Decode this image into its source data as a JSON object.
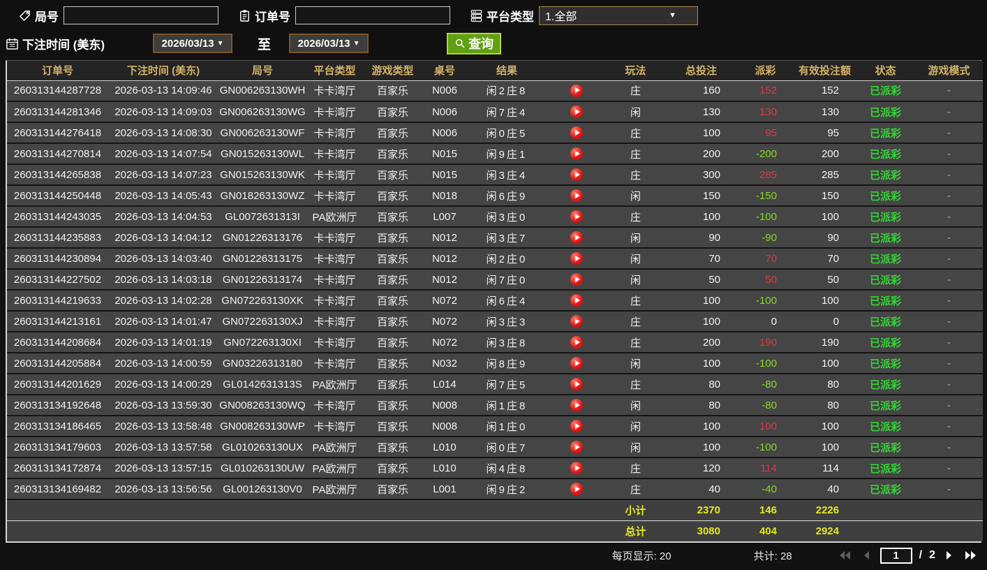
{
  "filters": {
    "round_label": "局号",
    "round_value": "",
    "order_label": "订单号",
    "order_value": "",
    "platform_label": "平台类型",
    "platform_value": "1.全部",
    "bet_time_label": "下注时间 (美东)",
    "date_from": "2026/03/13",
    "to_label": "至",
    "date_to": "2026/03/13",
    "search_label": "查询"
  },
  "table": {
    "columns": [
      "订单号",
      "下注时间 (美东)",
      "局号",
      "平台类型",
      "游戏类型",
      "桌号",
      "结果",
      "",
      "玩法",
      "总投注",
      "派彩",
      "有效投注额",
      "状态",
      "游戏模式"
    ],
    "rows": [
      {
        "order_id": "260313144287728",
        "bet_time": "2026-03-13 14:09:46",
        "round_id": "GN006263130WH",
        "platform": "卡卡湾厅",
        "game_type": "百家乐",
        "table_no": "N006",
        "result": "闲2庄8",
        "play": "庄",
        "total_bet": "160",
        "payout": "152",
        "payout_color": "red",
        "valid_bet": "152",
        "status": "已派彩",
        "mode": "-"
      },
      {
        "order_id": "260313144281346",
        "bet_time": "2026-03-13 14:09:03",
        "round_id": "GN006263130WG",
        "platform": "卡卡湾厅",
        "game_type": "百家乐",
        "table_no": "N006",
        "result": "闲7庄4",
        "play": "闲",
        "total_bet": "130",
        "payout": "130",
        "payout_color": "red",
        "valid_bet": "130",
        "status": "已派彩",
        "mode": "-"
      },
      {
        "order_id": "260313144276418",
        "bet_time": "2026-03-13 14:08:30",
        "round_id": "GN006263130WF",
        "platform": "卡卡湾厅",
        "game_type": "百家乐",
        "table_no": "N006",
        "result": "闲0庄5",
        "play": "庄",
        "total_bet": "100",
        "payout": "95",
        "payout_color": "red",
        "valid_bet": "95",
        "status": "已派彩",
        "mode": "-"
      },
      {
        "order_id": "260313144270814",
        "bet_time": "2026-03-13 14:07:54",
        "round_id": "GN015263130WL",
        "platform": "卡卡湾厅",
        "game_type": "百家乐",
        "table_no": "N015",
        "result": "闲9庄1",
        "play": "庄",
        "total_bet": "200",
        "payout": "-200",
        "payout_color": "green",
        "valid_bet": "200",
        "status": "已派彩",
        "mode": "-"
      },
      {
        "order_id": "260313144265838",
        "bet_time": "2026-03-13 14:07:23",
        "round_id": "GN015263130WK",
        "platform": "卡卡湾厅",
        "game_type": "百家乐",
        "table_no": "N015",
        "result": "闲3庄4",
        "play": "庄",
        "total_bet": "300",
        "payout": "285",
        "payout_color": "red",
        "valid_bet": "285",
        "status": "已派彩",
        "mode": "-"
      },
      {
        "order_id": "260313144250448",
        "bet_time": "2026-03-13 14:05:43",
        "round_id": "GN018263130WZ",
        "platform": "卡卡湾厅",
        "game_type": "百家乐",
        "table_no": "N018",
        "result": "闲6庄9",
        "play": "闲",
        "total_bet": "150",
        "payout": "-150",
        "payout_color": "green",
        "valid_bet": "150",
        "status": "已派彩",
        "mode": "-"
      },
      {
        "order_id": "260313144243035",
        "bet_time": "2026-03-13 14:04:53",
        "round_id": "GL0072631313I",
        "platform": "PA欧洲厅",
        "game_type": "百家乐",
        "table_no": "L007",
        "result": "闲3庄0",
        "play": "庄",
        "total_bet": "100",
        "payout": "-100",
        "payout_color": "green",
        "valid_bet": "100",
        "status": "已派彩",
        "mode": "-"
      },
      {
        "order_id": "260313144235883",
        "bet_time": "2026-03-13 14:04:12",
        "round_id": "GN01226313176",
        "platform": "卡卡湾厅",
        "game_type": "百家乐",
        "table_no": "N012",
        "result": "闲3庄7",
        "play": "闲",
        "total_bet": "90",
        "payout": "-90",
        "payout_color": "green",
        "valid_bet": "90",
        "status": "已派彩",
        "mode": "-"
      },
      {
        "order_id": "260313144230894",
        "bet_time": "2026-03-13 14:03:40",
        "round_id": "GN01226313175",
        "platform": "卡卡湾厅",
        "game_type": "百家乐",
        "table_no": "N012",
        "result": "闲2庄0",
        "play": "闲",
        "total_bet": "70",
        "payout": "70",
        "payout_color": "red",
        "valid_bet": "70",
        "status": "已派彩",
        "mode": "-"
      },
      {
        "order_id": "260313144227502",
        "bet_time": "2026-03-13 14:03:18",
        "round_id": "GN01226313174",
        "platform": "卡卡湾厅",
        "game_type": "百家乐",
        "table_no": "N012",
        "result": "闲7庄0",
        "play": "闲",
        "total_bet": "50",
        "payout": "50",
        "payout_color": "red",
        "valid_bet": "50",
        "status": "已派彩",
        "mode": "-"
      },
      {
        "order_id": "260313144219633",
        "bet_time": "2026-03-13 14:02:28",
        "round_id": "GN072263130XK",
        "platform": "卡卡湾厅",
        "game_type": "百家乐",
        "table_no": "N072",
        "result": "闲6庄4",
        "play": "庄",
        "total_bet": "100",
        "payout": "-100",
        "payout_color": "green",
        "valid_bet": "100",
        "status": "已派彩",
        "mode": "-"
      },
      {
        "order_id": "260313144213161",
        "bet_time": "2026-03-13 14:01:47",
        "round_id": "GN072263130XJ",
        "platform": "卡卡湾厅",
        "game_type": "百家乐",
        "table_no": "N072",
        "result": "闲3庄3",
        "play": "庄",
        "total_bet": "100",
        "payout": "0",
        "payout_color": "white",
        "valid_bet": "0",
        "status": "已派彩",
        "mode": "-"
      },
      {
        "order_id": "260313144208684",
        "bet_time": "2026-03-13 14:01:19",
        "round_id": "GN072263130XI",
        "platform": "卡卡湾厅",
        "game_type": "百家乐",
        "table_no": "N072",
        "result": "闲3庄8",
        "play": "庄",
        "total_bet": "200",
        "payout": "190",
        "payout_color": "red",
        "valid_bet": "190",
        "status": "已派彩",
        "mode": "-"
      },
      {
        "order_id": "260313144205884",
        "bet_time": "2026-03-13 14:00:59",
        "round_id": "GN03226313180",
        "platform": "卡卡湾厅",
        "game_type": "百家乐",
        "table_no": "N032",
        "result": "闲8庄9",
        "play": "闲",
        "total_bet": "100",
        "payout": "-100",
        "payout_color": "green",
        "valid_bet": "100",
        "status": "已派彩",
        "mode": "-"
      },
      {
        "order_id": "260313144201629",
        "bet_time": "2026-03-13 14:00:29",
        "round_id": "GL0142631313S",
        "platform": "PA欧洲厅",
        "game_type": "百家乐",
        "table_no": "L014",
        "result": "闲7庄5",
        "play": "庄",
        "total_bet": "80",
        "payout": "-80",
        "payout_color": "green",
        "valid_bet": "80",
        "status": "已派彩",
        "mode": "-"
      },
      {
        "order_id": "260313134192648",
        "bet_time": "2026-03-13 13:59:30",
        "round_id": "GN008263130WQ",
        "platform": "卡卡湾厅",
        "game_type": "百家乐",
        "table_no": "N008",
        "result": "闲1庄8",
        "play": "闲",
        "total_bet": "80",
        "payout": "-80",
        "payout_color": "green",
        "valid_bet": "80",
        "status": "已派彩",
        "mode": "-"
      },
      {
        "order_id": "260313134186465",
        "bet_time": "2026-03-13 13:58:48",
        "round_id": "GN008263130WP",
        "platform": "卡卡湾厅",
        "game_type": "百家乐",
        "table_no": "N008",
        "result": "闲1庄0",
        "play": "闲",
        "total_bet": "100",
        "payout": "100",
        "payout_color": "red",
        "valid_bet": "100",
        "status": "已派彩",
        "mode": "-"
      },
      {
        "order_id": "260313134179603",
        "bet_time": "2026-03-13 13:57:58",
        "round_id": "GL010263130UX",
        "platform": "PA欧洲厅",
        "game_type": "百家乐",
        "table_no": "L010",
        "result": "闲0庄7",
        "play": "闲",
        "total_bet": "100",
        "payout": "-100",
        "payout_color": "green",
        "valid_bet": "100",
        "status": "已派彩",
        "mode": "-"
      },
      {
        "order_id": "260313134172874",
        "bet_time": "2026-03-13 13:57:15",
        "round_id": "GL010263130UW",
        "platform": "PA欧洲厅",
        "game_type": "百家乐",
        "table_no": "L010",
        "result": "闲4庄8",
        "play": "庄",
        "total_bet": "120",
        "payout": "114",
        "payout_color": "red",
        "valid_bet": "114",
        "status": "已派彩",
        "mode": "-"
      },
      {
        "order_id": "260313134169482",
        "bet_time": "2026-03-13 13:56:56",
        "round_id": "GL001263130V0",
        "platform": "PA欧洲厅",
        "game_type": "百家乐",
        "table_no": "L001",
        "result": "闲9庄2",
        "play": "庄",
        "total_bet": "40",
        "payout": "-40",
        "payout_color": "green",
        "valid_bet": "40",
        "status": "已派彩",
        "mode": "-"
      }
    ],
    "subtotal": {
      "label": "小计",
      "total_bet": "2370",
      "payout": "146",
      "valid_bet": "2226"
    },
    "grand_total": {
      "label": "总计",
      "total_bet": "3080",
      "payout": "404",
      "valid_bet": "2924"
    }
  },
  "footer": {
    "per_page_label": "每页显示: 20",
    "total_count_label": "共计: 28",
    "current_page": "1",
    "page_separator": "/",
    "total_pages": "2"
  },
  "colors": {
    "header_gold": "#d5b267",
    "status_green": "#33d433",
    "payout_positive_red": "#d93a46",
    "payout_negative_green": "#86d926",
    "totals_yellow": "#e3e821",
    "search_button_green": "#61a013",
    "date_border_brown": "#7d5426"
  }
}
